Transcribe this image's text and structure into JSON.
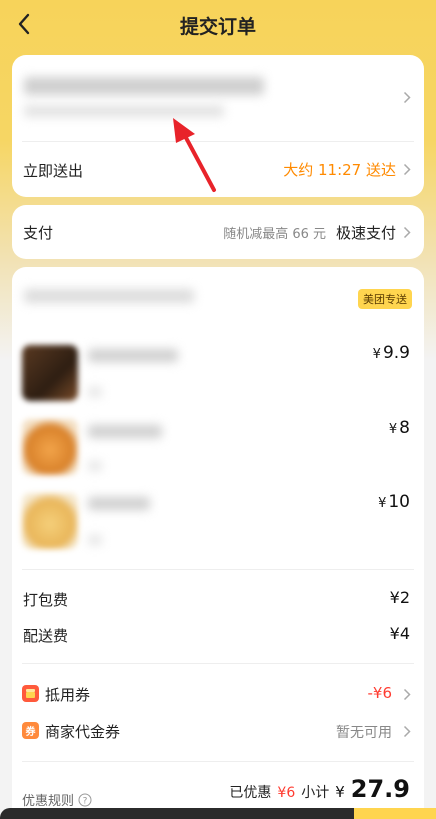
{
  "nav": {
    "title": "提交订单"
  },
  "delivery": {
    "label": "立即送出",
    "eta": "大约 11:27 送达"
  },
  "payment": {
    "label": "支付",
    "hint": "随机减最高 66 元",
    "method": "极速支付"
  },
  "store": {
    "badge": "美团专送"
  },
  "items": [
    {
      "price": "9.9"
    },
    {
      "price": "8"
    },
    {
      "price": "10"
    }
  ],
  "currency": "¥",
  "fees": {
    "packing_label": "打包费",
    "packing_value": "¥2",
    "delivery_label": "配送费",
    "delivery_value": "¥4"
  },
  "coupons": {
    "voucher_label": "抵用券",
    "voucher_value": "-¥6",
    "merchant_label": "商家代金券",
    "merchant_value": "暂无可用"
  },
  "summary": {
    "rules_label": "优惠规则",
    "saved_label": "已优惠",
    "saved_value": "¥6",
    "subtotal_label": "小计",
    "subtotal_currency": "¥",
    "subtotal_value": "27.9"
  },
  "colors": {
    "accent": "#ffd54f",
    "eta": "#ff8a00",
    "discount": "#ff3b30",
    "annotation": "#e8232a"
  }
}
